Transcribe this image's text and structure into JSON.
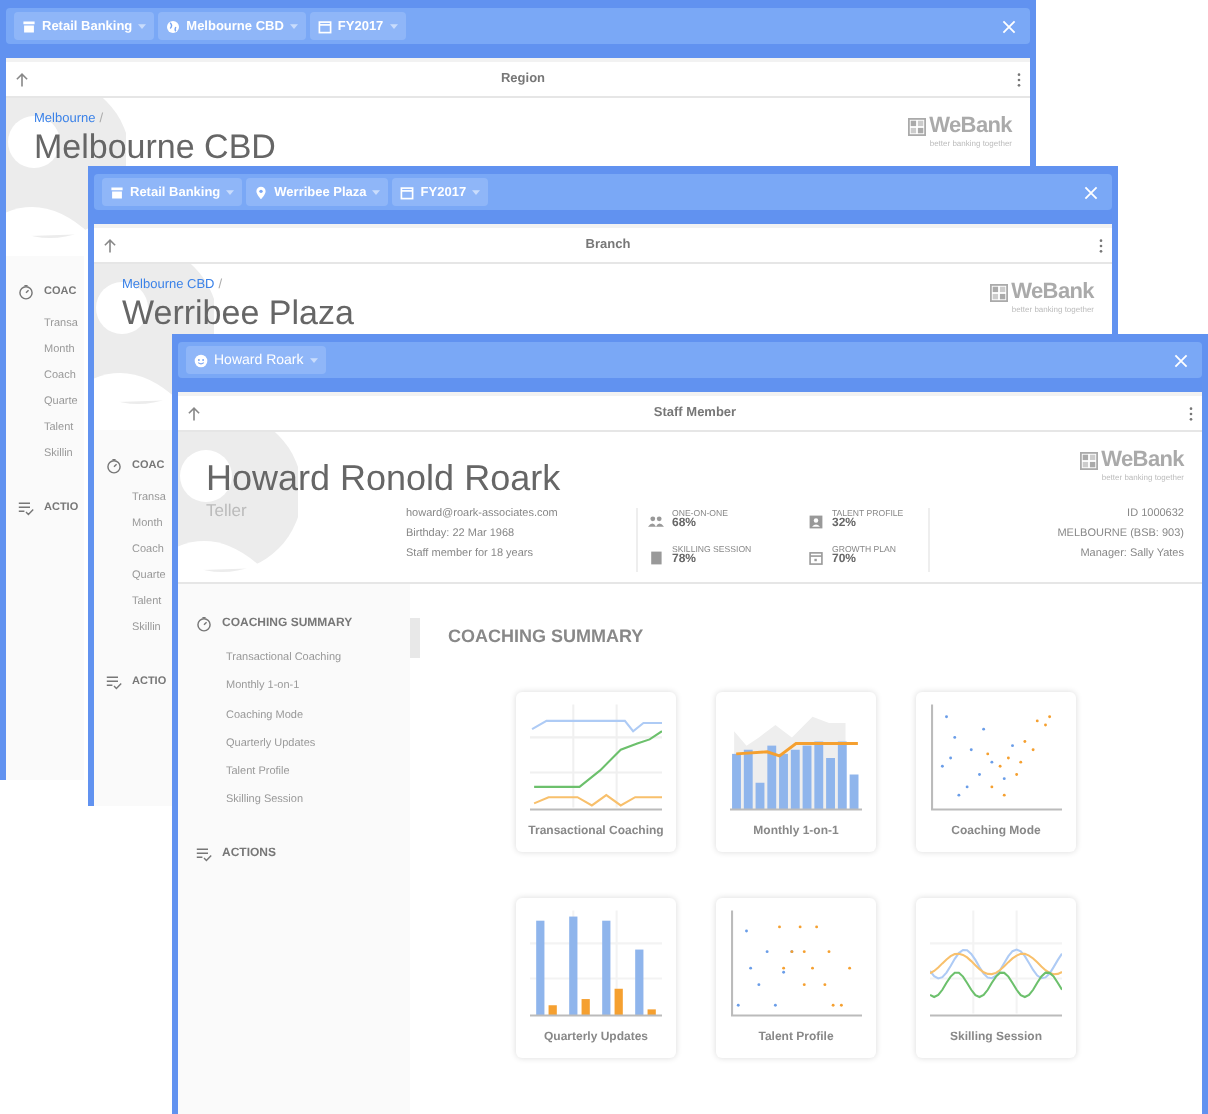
{
  "windows": [
    {
      "chips": [
        {
          "kind": "division",
          "label": "Retail Banking"
        },
        {
          "kind": "area",
          "label": "Melbourne CBD"
        },
        {
          "kind": "period",
          "label": "FY2017"
        }
      ],
      "card_title": "Region",
      "breadcrumb": "Melbourne",
      "separator": "/",
      "title": "Melbourne CBD",
      "logo": {
        "name": "WeBank",
        "tagline": "better banking together"
      },
      "sidebar": [
        {
          "kind": "coaching",
          "label": "COAC",
          "items": [
            "Transa",
            "Month",
            "Coach",
            "Quarte",
            "Talent",
            "Skillin"
          ]
        },
        {
          "kind": "actions",
          "label": "ACTIO"
        }
      ]
    },
    {
      "chips": [
        {
          "kind": "division",
          "label": "Retail Banking"
        },
        {
          "kind": "place",
          "label": "Werribee Plaza"
        },
        {
          "kind": "period",
          "label": "FY2017"
        }
      ],
      "card_title": "Branch",
      "breadcrumb": "Melbourne CBD",
      "separator": "/",
      "title": "Werribee Plaza",
      "logo": {
        "name": "WeBank",
        "tagline": "better banking together"
      },
      "sidebar": [
        {
          "kind": "coaching",
          "label": "COAC",
          "items": [
            "Transa",
            "Month",
            "Coach",
            "Quarte",
            "Talent",
            "Skillin"
          ]
        },
        {
          "kind": "actions",
          "label": "ACTIO"
        }
      ]
    },
    {
      "chips": [
        {
          "kind": "person",
          "label": "Howard Roark"
        }
      ],
      "card_title": "Staff Member",
      "title": "Howard Ronold Roark",
      "role": "Teller",
      "logo": {
        "name": "WeBank",
        "tagline": "better banking together"
      },
      "details": [
        "howard@roark-associates.com",
        "Birthday: 22 Mar 1968",
        "Staff member for 18 years"
      ],
      "stats": [
        {
          "kind": "people",
          "label": "ONE-ON-ONE",
          "value": "68%"
        },
        {
          "kind": "badge",
          "label": "TALENT PROFILE",
          "value": "32%"
        },
        {
          "kind": "book",
          "label": "SKILLING SESSION",
          "value": "78%"
        },
        {
          "kind": "calendar",
          "label": "GROWTH PLAN",
          "value": "70%"
        }
      ],
      "ids": [
        "ID 1000632",
        "MELBOURNE (BSB: 903)",
        "Manager: Sally Yates"
      ],
      "sidebar": [
        {
          "kind": "coaching",
          "label": "COACHING SUMMARY",
          "items": [
            "Transactional Coaching",
            "Monthly 1-on-1",
            "Coaching Mode",
            "Quarterly Updates",
            "Talent Profile",
            "Skilling Session"
          ]
        },
        {
          "kind": "actions",
          "label": "ACTIONS"
        }
      ],
      "heading": "COACHING SUMMARY",
      "cards": [
        {
          "kind": "line",
          "label": "Transactional Coaching"
        },
        {
          "kind": "barline",
          "label": "Monthly 1-on-1"
        },
        {
          "kind": "scatter",
          "label": "Coaching Mode"
        },
        {
          "kind": "bar",
          "label": "Quarterly Updates"
        },
        {
          "kind": "dots",
          "label": "Talent Profile"
        },
        {
          "kind": "wave",
          "label": "Skilling Session"
        }
      ]
    }
  ]
}
